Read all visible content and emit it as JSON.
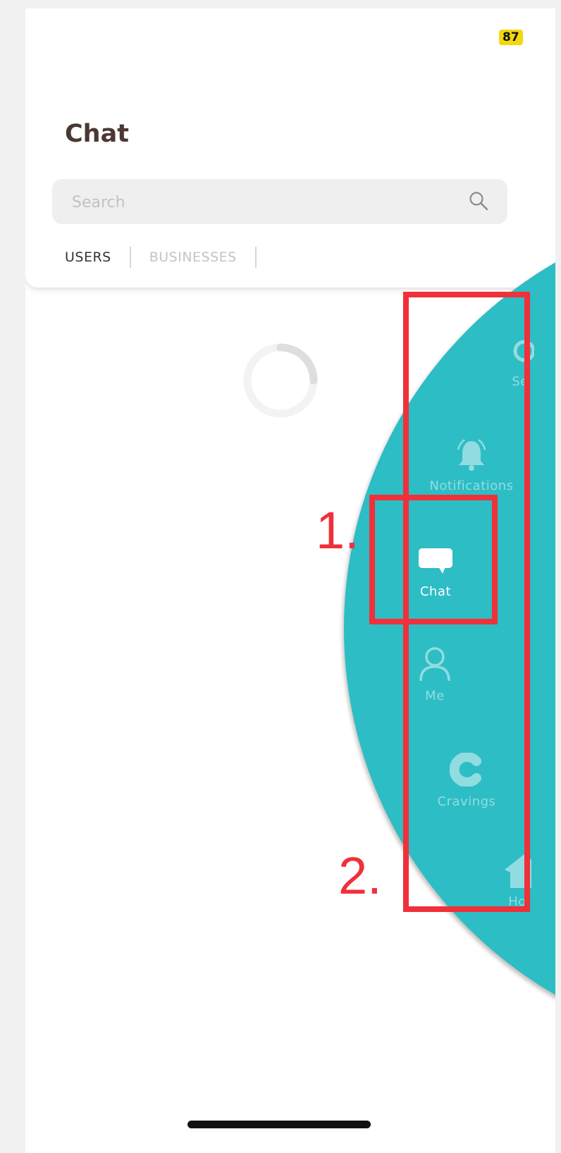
{
  "status_bar": {
    "battery": "87"
  },
  "header": {
    "title": "Chat"
  },
  "search": {
    "placeholder": "Search"
  },
  "tabs": [
    {
      "label": "USERS"
    },
    {
      "label": "BUSINESSES"
    }
  ],
  "side_nav": {
    "items": [
      {
        "label": "Se",
        "icon": "settings-icon"
      },
      {
        "label": "Notifications",
        "icon": "bell-icon"
      },
      {
        "label": "Chat",
        "icon": "chat-bubble-icon",
        "active": true
      },
      {
        "label": "Me",
        "icon": "person-icon"
      },
      {
        "label": "Cravings",
        "icon": "cravings-logo-icon"
      },
      {
        "label": "Ho",
        "icon": "home-icon"
      }
    ]
  },
  "annotations": {
    "label_1": "1.",
    "label_2": "2."
  },
  "colors": {
    "teal": "#2dbdc5",
    "annotation_red": "#f0303a",
    "title_brown": "#4b3832",
    "battery_yellow": "#f2d80d"
  }
}
